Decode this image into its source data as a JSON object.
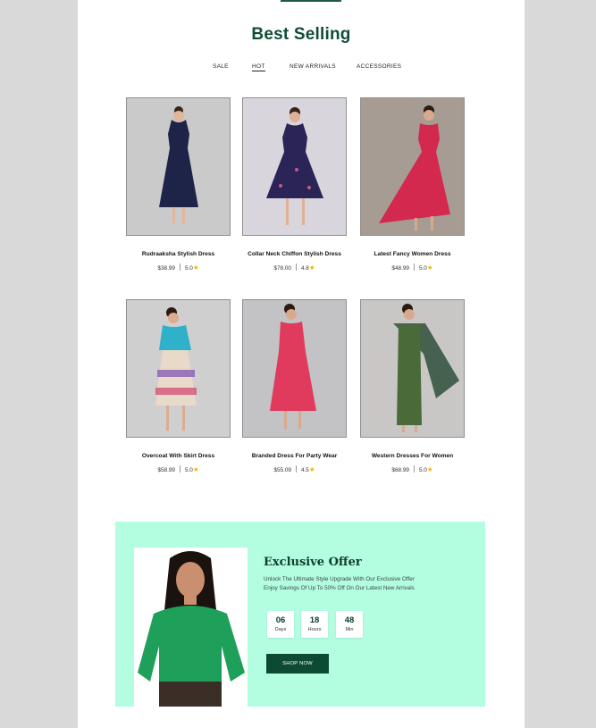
{
  "section_title": "Best Selling",
  "tabs": [
    "SALE",
    "HOT",
    "NEW ARRIVALS",
    "ACCESSORIES"
  ],
  "active_tab": "HOT",
  "products": [
    {
      "name": "Rudraaksha Stylish Dress",
      "price": "$38.99",
      "rating": "5.0",
      "dress_color": "#1e2447"
    },
    {
      "name": "Collar Neck Chiffon Stylish Dress",
      "price": "$78.00",
      "rating": "4.8",
      "dress_color": "#2b2457"
    },
    {
      "name": "Latest Fancy Women Dress",
      "price": "$48.99",
      "rating": "5.0",
      "dress_color": "#d4294f"
    },
    {
      "name": "Overcoat With Skirt Dress",
      "price": "$58.99",
      "rating": "5.0",
      "dress_color": "#2fb1c9"
    },
    {
      "name": "Branded Dress For Party Wear",
      "price": "$55.09",
      "rating": "4.5",
      "dress_color": "#e03a5c"
    },
    {
      "name": "Western Dresses For Women",
      "price": "$68.99",
      "rating": "5.0",
      "dress_color": "#4b6a3a"
    }
  ],
  "offer": {
    "title": "Exclusive Offer",
    "line1": "Unlock The Ultimate Style Upgrade With Our Exclusive Offer",
    "line2": "Enjoy Savings Of Up To 50% Off On Our Latest New Arrivals",
    "countdown": [
      {
        "value": "06",
        "unit": "Days"
      },
      {
        "value": "18",
        "unit": "Hours"
      },
      {
        "value": "48",
        "unit": "Min"
      }
    ],
    "button_label": "SHOP NOW"
  },
  "colors": {
    "accent": "#0f4d34",
    "offer_bg": "#b3fde0",
    "star": "#f5b301"
  }
}
